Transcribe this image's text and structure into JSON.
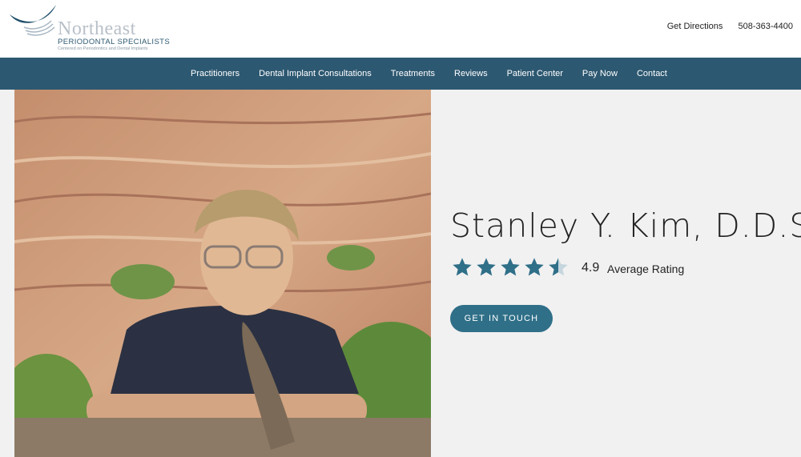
{
  "logo": {
    "name": "Northeast",
    "subtitle": "PERIODONTAL SPECIALISTS",
    "tagline": "Centered on Periodontics and Dental Implants"
  },
  "header": {
    "directions_label": "Get Directions",
    "phone": "508-363-4400"
  },
  "nav": {
    "items": [
      "Practitioners",
      "Dental Implant Consultations",
      "Treatments",
      "Reviews",
      "Patient Center",
      "Pay Now",
      "Contact"
    ]
  },
  "hero": {
    "photo_icon": "doctor-portrait",
    "doctor_name": "Stanley Y. Kim, D.D.S.",
    "rating_value": "4.9",
    "rating_label": "Average Rating",
    "rating_stars": 4.5,
    "cta_label": "GET IN TOUCH"
  },
  "colors": {
    "nav_bg": "#2d5871",
    "accent": "#2f6f88",
    "star": "#2f6f88"
  }
}
